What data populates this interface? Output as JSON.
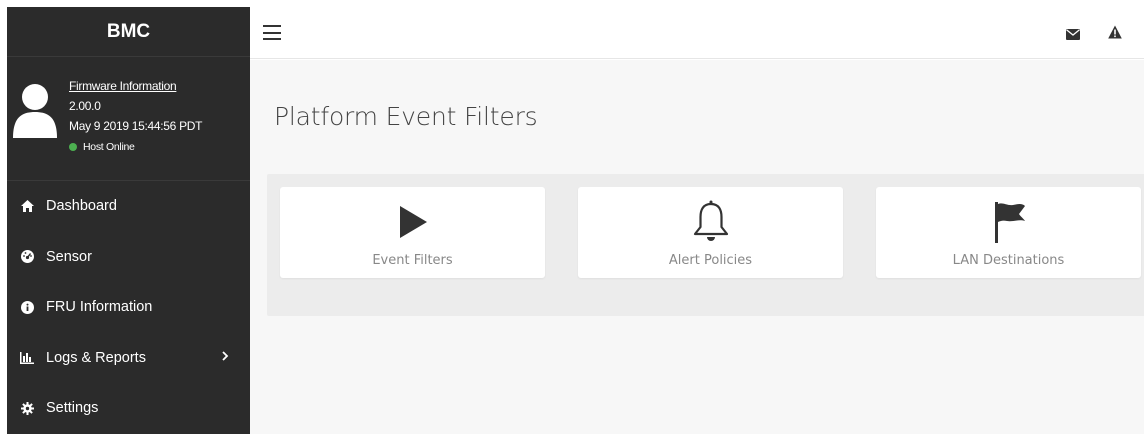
{
  "sidebar": {
    "brand": "BMC",
    "firmware": {
      "link_label": "Firmware Information",
      "version": "2.00.0",
      "build_date": "May 9 2019 15:44:56 PDT",
      "host_status": "Host Online",
      "host_status_color": "#4caf50"
    },
    "menu": [
      {
        "label": "Dashboard",
        "icon": "home-icon"
      },
      {
        "label": "Sensor",
        "icon": "dashboard-gauge-icon"
      },
      {
        "label": "FRU Information",
        "icon": "info-icon"
      },
      {
        "label": "Logs & Reports",
        "icon": "bar-chart-icon",
        "has_submenu": true
      },
      {
        "label": "Settings",
        "icon": "gear-icon"
      }
    ]
  },
  "topbar": {
    "menu_icon": "hamburger-icon",
    "notifications_icon": "envelope-icon",
    "alerts_icon": "warning-icon"
  },
  "main": {
    "title": "Platform Event Filters",
    "cards": [
      {
        "label": "Event Filters",
        "icon": "play-icon"
      },
      {
        "label": "Alert Policies",
        "icon": "bell-icon"
      },
      {
        "label": "LAN Destinations",
        "icon": "flag-icon"
      }
    ]
  },
  "colors": {
    "sidebar_bg": "#2b2b2b",
    "content_bg": "#f7f7f7",
    "panel_bg": "#ececec",
    "icon_dark": "#333333"
  }
}
